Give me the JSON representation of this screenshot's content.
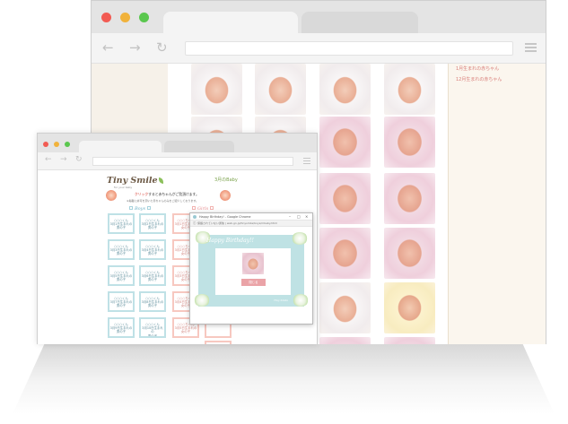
{
  "back_browser": {
    "sidebar_links": [
      "1月生まれの赤ちゃん",
      "12月生まれの赤ちゃん"
    ]
  },
  "front_browser": {
    "logo_text": "Tiny Smile",
    "logo_subtitle": "for your baby",
    "page_title": "3月のBaby",
    "instruction_strong": "クリック",
    "instruction_text": "すると赤ちゃんがご覧頂けます。",
    "note": "※掲載に許可を頂いた赤ちゃんのみをご紹介しております。",
    "section_boys": "Boys",
    "section_girls": "Girls",
    "boy_cards": [
      [
        "○○○くん",
        "3月1日生まれの",
        "男の子"
      ],
      [
        "○○○くん",
        "3月2日生まれの",
        "男の子"
      ],
      [
        "○○○くん",
        "3月3日生まれの",
        "男の子"
      ],
      [
        "○○○くん",
        "3月4日生まれの",
        "男の子"
      ],
      [
        "○○○くん",
        "3月5日生まれの",
        "男の子"
      ],
      [
        "○○○くん",
        "3月6日生まれの",
        "男の子"
      ],
      [
        "○○○くん",
        "3月7日生まれの",
        "男の子"
      ],
      [
        "○○○くん",
        "3月8日生まれの",
        "男の子"
      ],
      [
        "○○○くん",
        "3月9日生まれの",
        "男の子"
      ],
      [
        "○○○くん",
        "3月10日生まれの",
        "男の子"
      ]
    ],
    "girl_cards": [
      [
        "○○○ちゃん",
        "3月1日生まれの",
        "女の子"
      ],
      [
        "○○○ちゃん",
        "3月2日生まれの",
        "女の子"
      ],
      [
        "○○○ちゃん",
        "3月3日生まれの",
        "女の子"
      ],
      [
        "○○○ちゃん",
        "3月4日生まれの",
        "女の子"
      ],
      [
        "○○○ちゃん",
        "3月5日生まれの",
        "女の子"
      ]
    ]
  },
  "popup": {
    "window_title": "Happy Birthday! - Google Chrome",
    "address": "保護されていない通信 | web.gn.jp/tinysmile/boys/mbaby.html",
    "header_text": "Happy Birthday!!",
    "button_label": "閉じる",
    "footer_text": "Tiny Smile"
  },
  "colors": {
    "boys_accent": "#6db0c6",
    "girls_accent": "#e98f91",
    "popup_frame": "#bfe2e4",
    "close_btn": "#eaa3a7",
    "brand_green": "#8cc05b"
  }
}
